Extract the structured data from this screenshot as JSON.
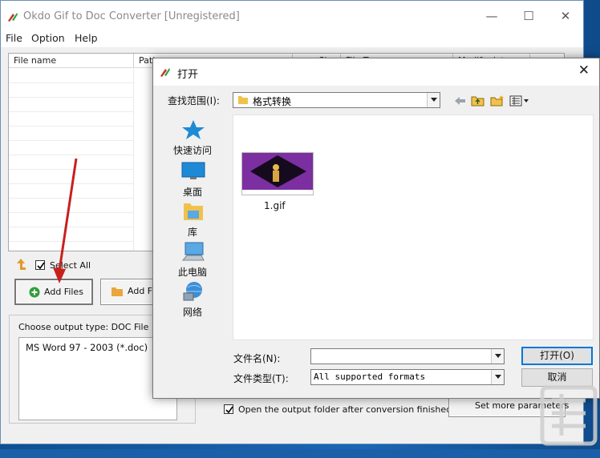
{
  "main": {
    "title": "Okdo Gif to Doc Converter [Unregistered]",
    "menu": [
      "File",
      "Option",
      "Help"
    ],
    "columns": [
      "File name",
      "Path",
      "Size",
      "File Type",
      "Modify date"
    ],
    "select_all": "Select All",
    "add_files": "Add Files",
    "add_folder": "Add Fo",
    "output_type_label": "Choose output type:  DOC File",
    "output_types": [
      "MS Word 97 - 2003 (*.doc)"
    ],
    "open_folder_label": "Open the output folder after conversion finished",
    "set_params": "Set more parameters"
  },
  "dialog": {
    "title": "打开",
    "look_in_label": "查找范围(I):",
    "look_in_value": "格式转换",
    "places": [
      "快速访问",
      "桌面",
      "库",
      "此电脑",
      "网络"
    ],
    "files": [
      {
        "name": "1.gif"
      }
    ],
    "filename_label": "文件名(N):",
    "filename_value": "",
    "filetype_label": "文件类型(T):",
    "filetype_value": "All supported formats",
    "open_button": "打开(O)",
    "cancel_button": "取消"
  },
  "colors": {
    "accent": "#0078d7",
    "annotation_arrow": "#c8201e",
    "add_icon": "#2e9e3a"
  }
}
